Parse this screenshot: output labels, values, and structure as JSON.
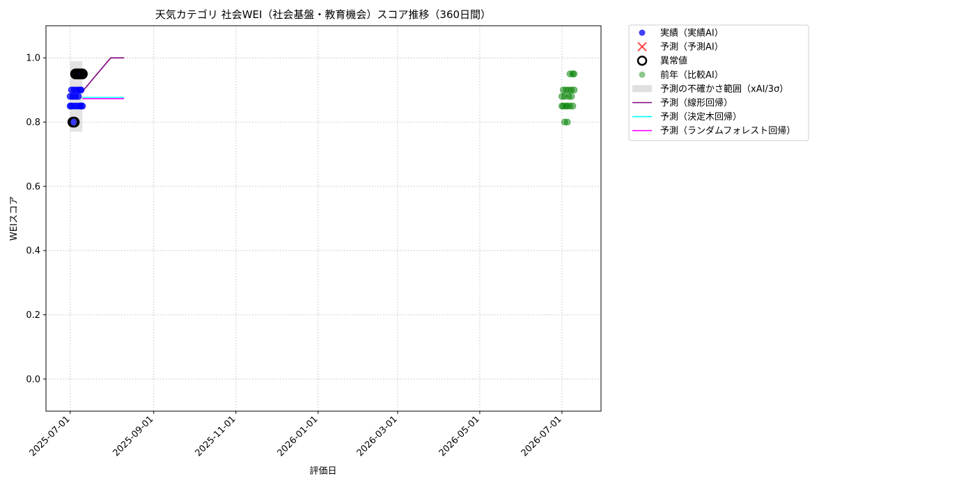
{
  "chart_data": {
    "type": "scatter",
    "title": "天気カテゴリ 社会WEI（社会基盤・教育機会）スコア推移（360日間）",
    "xlabel": "評価日",
    "ylabel": "WEIスコア",
    "x_range": [
      "2025-06-13",
      "2026-07-30"
    ],
    "ylim": [
      -0.1,
      1.1
    ],
    "x_ticks": [
      "2025-07-01",
      "2025-09-01",
      "2025-11-01",
      "2026-01-01",
      "2026-03-01",
      "2026-05-01",
      "2026-07-01"
    ],
    "y_ticks": [
      0.0,
      0.2,
      0.4,
      0.6,
      0.8,
      1.0
    ],
    "y_tick_labels": [
      "0.0",
      "0.2",
      "0.4",
      "0.6",
      "0.8",
      "1.0"
    ],
    "grid": true,
    "legend_position": "outside-right",
    "legend": [
      {
        "label": "実績（実績AI）",
        "kind": "dot",
        "color": "#0000ff"
      },
      {
        "label": "予測（予測AI）",
        "kind": "cross",
        "color": "#ff0000"
      },
      {
        "label": "異常値",
        "kind": "ring",
        "color": "#000000"
      },
      {
        "label": "前年（比較AI）",
        "kind": "dot",
        "color": "#008000"
      },
      {
        "label": "予測の不確かさ範囲（xAI/3σ）",
        "kind": "band",
        "color": "#cccccc"
      },
      {
        "label": "予測（線形回帰）",
        "kind": "line",
        "color": "#800080"
      },
      {
        "label": "予測（決定木回帰）",
        "kind": "line",
        "color": "#00ffff"
      },
      {
        "label": "予測（ランダムフォレスト回帰）",
        "kind": "line",
        "color": "#ff00ff"
      }
    ],
    "uncertainty_band": {
      "x": [
        "2025-07-01",
        "2025-07-10"
      ],
      "y": [
        0.77,
        0.99
      ],
      "color": "#cccccc"
    },
    "series": [
      {
        "name": "実績（実績AI）",
        "color": "#0000ff",
        "points": [
          [
            "2025-07-01",
            0.85
          ],
          [
            "2025-07-01",
            0.88
          ],
          [
            "2025-07-02",
            0.9
          ],
          [
            "2025-07-02",
            0.85
          ],
          [
            "2025-07-03",
            0.88
          ],
          [
            "2025-07-03",
            0.8
          ],
          [
            "2025-07-04",
            0.85
          ],
          [
            "2025-07-04",
            0.9
          ],
          [
            "2025-07-05",
            0.88
          ],
          [
            "2025-07-05",
            0.95
          ],
          [
            "2025-07-06",
            0.85
          ],
          [
            "2025-07-06",
            0.9
          ],
          [
            "2025-07-07",
            0.88
          ],
          [
            "2025-07-07",
            0.95
          ],
          [
            "2025-07-08",
            0.85
          ],
          [
            "2025-07-08",
            0.9
          ],
          [
            "2025-07-09",
            0.85
          ],
          [
            "2025-07-09",
            0.9
          ],
          [
            "2025-07-10",
            0.95
          ],
          [
            "2025-07-10",
            0.85
          ]
        ]
      },
      {
        "name": "異常値",
        "color": "#000000",
        "points": [
          [
            "2025-07-03",
            0.8
          ],
          [
            "2025-07-04",
            0.8
          ],
          [
            "2025-07-05",
            0.95
          ],
          [
            "2025-07-06",
            0.95
          ],
          [
            "2025-07-07",
            0.95
          ],
          [
            "2025-07-08",
            0.95
          ],
          [
            "2025-07-09",
            0.95
          ],
          [
            "2025-07-10",
            0.95
          ]
        ]
      },
      {
        "name": "前年（比較AI）",
        "color": "#008000",
        "points": [
          [
            "2026-07-01",
            0.85
          ],
          [
            "2026-07-01",
            0.88
          ],
          [
            "2026-07-02",
            0.9
          ],
          [
            "2026-07-02",
            0.85
          ],
          [
            "2026-07-03",
            0.8
          ],
          [
            "2026-07-03",
            0.88
          ],
          [
            "2026-07-04",
            0.85
          ],
          [
            "2026-07-04",
            0.9
          ],
          [
            "2026-07-05",
            0.8
          ],
          [
            "2026-07-05",
            0.85
          ],
          [
            "2026-07-06",
            0.9
          ],
          [
            "2026-07-06",
            0.88
          ],
          [
            "2026-07-07",
            0.95
          ],
          [
            "2026-07-07",
            0.85
          ],
          [
            "2026-07-08",
            0.88
          ],
          [
            "2026-07-08",
            0.9
          ],
          [
            "2026-07-09",
            0.95
          ],
          [
            "2026-07-09",
            0.85
          ],
          [
            "2026-07-10",
            0.9
          ],
          [
            "2026-07-10",
            0.95
          ]
        ]
      }
    ],
    "line_series": [
      {
        "name": "予測（線形回帰）",
        "color": "#800080",
        "points": [
          [
            "2025-07-10",
            0.895
          ],
          [
            "2025-07-31",
            1.0
          ],
          [
            "2025-08-10",
            1.0
          ]
        ]
      },
      {
        "name": "予測（決定木回帰）",
        "color": "#00ffff",
        "points": [
          [
            "2025-07-10",
            0.877
          ],
          [
            "2025-08-10",
            0.877
          ]
        ]
      },
      {
        "name": "予測（ランダムフォレスト回帰）",
        "color": "#ff00ff",
        "points": [
          [
            "2025-07-10",
            0.873
          ],
          [
            "2025-08-10",
            0.873
          ]
        ]
      }
    ]
  }
}
